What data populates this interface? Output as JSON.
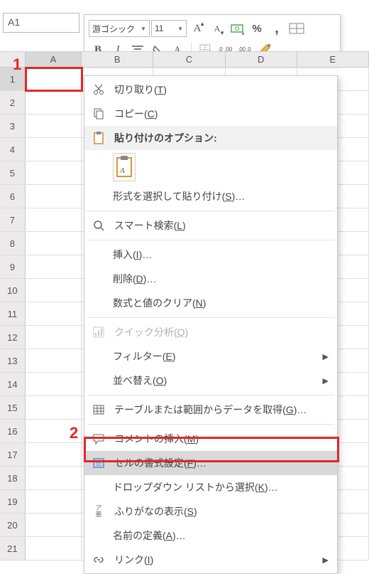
{
  "namebox": {
    "value": "A1"
  },
  "toolbar": {
    "font_name": "游ゴシック",
    "font_size": "11"
  },
  "columns": [
    "A",
    "B",
    "C",
    "D",
    "E"
  ],
  "rows": [
    1,
    2,
    3,
    4,
    5,
    6,
    7,
    8,
    9,
    10,
    11,
    12,
    13,
    14,
    15,
    16,
    17,
    18,
    19,
    20,
    21
  ],
  "annotations": {
    "a1": "1",
    "a2": "2"
  },
  "menu": {
    "cut": "切り取り(T)",
    "copy": "コピー(C)",
    "paste_header": "貼り付けのオプション:",
    "paste_special": "形式を選択して貼り付け(S)…",
    "smart_lookup": "スマート検索(L)",
    "insert": "挿入(I)…",
    "delete": "削除(D)…",
    "clear": "数式と値のクリア(N)",
    "quick_analysis": "クイック分析(Q)",
    "filter": "フィルター(E)",
    "sort": "並べ替え(O)",
    "get_data": "テーブルまたは範囲からデータを取得(G)…",
    "insert_comment": "コメントの挿入(M)",
    "format_cells": "セルの書式設定(F)…",
    "dropdown_pick": "ドロップダウン リストから選択(K)…",
    "phonetic": "ふりがなの表示(S)",
    "define_name": "名前の定義(A)…",
    "link": "リンク(I)"
  }
}
